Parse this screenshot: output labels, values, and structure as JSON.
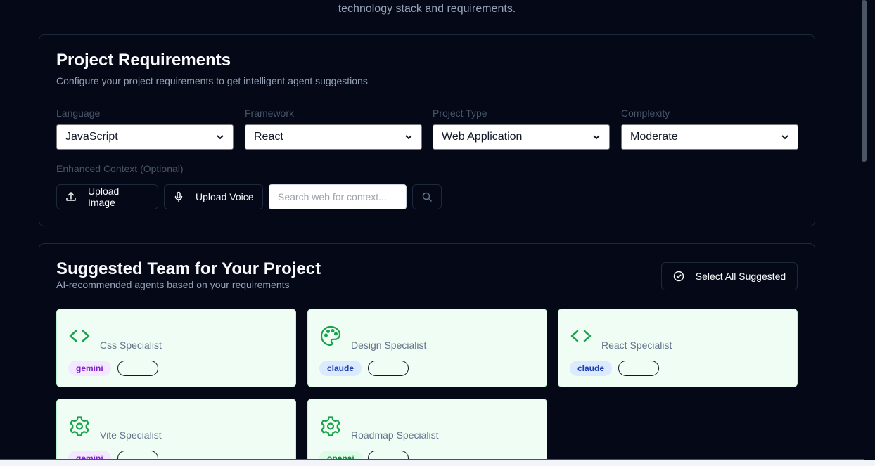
{
  "header": {
    "description": "technology stack and requirements."
  },
  "requirements": {
    "title": "Project Requirements",
    "subtitle": "Configure your project requirements to get intelligent agent suggestions",
    "fields": [
      {
        "label": "Language",
        "value": "JavaScript"
      },
      {
        "label": "Framework",
        "value": "React"
      },
      {
        "label": "Project Type",
        "value": "Web Application"
      },
      {
        "label": "Complexity",
        "value": "Moderate"
      }
    ],
    "context": {
      "label": "Enhanced Context (Optional)",
      "upload_image": "Upload Image",
      "upload_voice": "Upload Voice",
      "search_placeholder": "Search web for context...",
      "search_icon": "search-icon"
    }
  },
  "team": {
    "title": "Suggested Team for Your Project",
    "subtitle": "AI-recommended agents based on your requirements",
    "select_all": "Select All Suggested",
    "agents": [
      {
        "icon": "code-icon",
        "name": "",
        "role": "Css Specialist",
        "provider": "gemini",
        "tag": ""
      },
      {
        "icon": "palette-icon",
        "name": "",
        "role": "Design Specialist",
        "provider": "claude",
        "tag": ""
      },
      {
        "icon": "code-icon",
        "name": "",
        "role": "React Specialist",
        "provider": "claude",
        "tag": ""
      },
      {
        "icon": "gear-icon",
        "name": "",
        "role": "Vite Specialist",
        "provider": "gemini",
        "tag": ""
      },
      {
        "icon": "gear-icon",
        "name": "",
        "role": "Roadmap Specialist",
        "provider": "openai",
        "tag": ""
      }
    ]
  },
  "colors": {
    "background": "#050816",
    "card_border": "#1e293b",
    "agent_card_bg": "#f0fdf4",
    "icon_green": "#16a34a",
    "muted_text": "#94a3b8"
  }
}
